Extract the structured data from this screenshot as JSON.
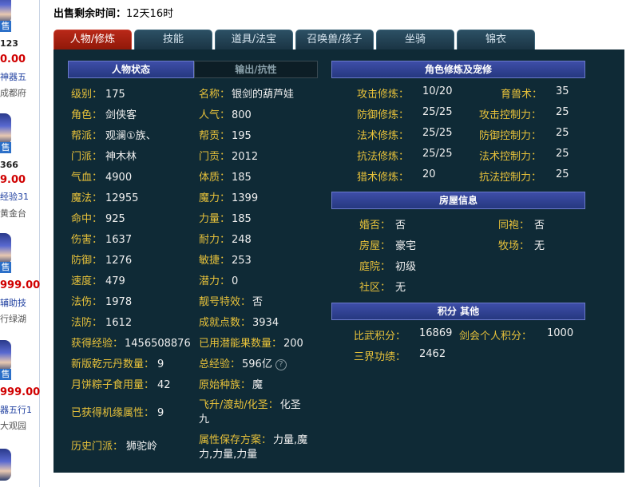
{
  "left_strip": {
    "items": [
      {
        "id": "123",
        "price": "0.00",
        "desc": "神器五",
        "server": "成都府",
        "badge": "售"
      },
      {
        "id": "366",
        "price": "9.00",
        "desc": "经验31",
        "server": "黄金台",
        "badge": "售"
      },
      {
        "id": "",
        "price": "999.00",
        "desc": "辅助技",
        "server": "行绿湖",
        "badge": "售"
      },
      {
        "id": "",
        "price": "999.00",
        "desc": "器五行1",
        "server": "大观园",
        "badge": "售"
      }
    ]
  },
  "sale": {
    "label": "出售剩余时间：",
    "value": "12天16时"
  },
  "tabs": [
    "人物/修炼",
    "技能",
    "道具/法宝",
    "召唤兽/孩子",
    "坐骑",
    "锦衣"
  ],
  "panel": {
    "left_header": "人物状态",
    "left_header2": "输出/抗性",
    "col1": [
      {
        "label": "级别：",
        "value": "175"
      },
      {
        "label": "角色：",
        "value": "剑侠客"
      },
      {
        "label": "帮派：",
        "value": "观澜①族、"
      },
      {
        "label": "门派：",
        "value": "神木林"
      },
      {
        "label": "气血：",
        "value": "4900"
      },
      {
        "label": "魔法：",
        "value": "12955"
      },
      {
        "label": "命中：",
        "value": "925"
      },
      {
        "label": "伤害：",
        "value": "1637"
      },
      {
        "label": "防御：",
        "value": "1276"
      },
      {
        "label": "速度：",
        "value": "479"
      },
      {
        "label": "法伤：",
        "value": "1978"
      },
      {
        "label": "法防：",
        "value": "1612"
      },
      {
        "label": "获得经验：",
        "value": "1456508876"
      },
      {
        "label": "新版乾元丹数量：",
        "value": "9"
      },
      {
        "label": "月饼粽子食用量：",
        "value": "42"
      },
      {
        "label": "已获得机缘属性：",
        "value": "9"
      },
      {
        "label": "历史门派：",
        "value": "狮驼岭"
      }
    ],
    "col2": [
      {
        "label": "名称：",
        "value": "银剑的葫芦娃"
      },
      {
        "label": "人气：",
        "value": "800"
      },
      {
        "label": "帮贡：",
        "value": "195"
      },
      {
        "label": "门贡：",
        "value": "2012"
      },
      {
        "label": "体质：",
        "value": "185"
      },
      {
        "label": "魔力：",
        "value": "1399"
      },
      {
        "label": "力量：",
        "value": "185"
      },
      {
        "label": "耐力：",
        "value": "248"
      },
      {
        "label": "敏捷：",
        "value": "253"
      },
      {
        "label": "潜力：",
        "value": "0"
      },
      {
        "label": "靓号特效：",
        "value": "否"
      },
      {
        "label": "成就点数：",
        "value": "3934"
      },
      {
        "label": "已用潜能果数量：",
        "value": "200"
      },
      {
        "label": "总经验：",
        "value": "596亿"
      }
    ],
    "fly": {
      "label": "飞升/渡劫/化圣：",
      "value": "化圣",
      "value2": "九"
    },
    "attr_plan": {
      "label": "属性保存方案：",
      "value": "力量,魔",
      "value2": "力,力量,力量"
    },
    "cultivation_header": "角色修炼及宠修",
    "cultivation": [
      {
        "label": "攻击修炼：",
        "value": "10/20",
        "label2": "育兽术：",
        "value2": "35"
      },
      {
        "label": "防御修炼：",
        "value": "25/25",
        "label2": "攻击控制力：",
        "value2": "25"
      },
      {
        "label": "法术修炼：",
        "value": "25/25",
        "label2": "防御控制力：",
        "value2": "25"
      },
      {
        "label": "抗法修炼：",
        "value": "25/25",
        "label2": "法术控制力：",
        "value2": "25"
      },
      {
        "label": "猎术修炼：",
        "value": "20",
        "label2": "抗法控制力：",
        "value2": "25"
      }
    ],
    "house_header": "房屋信息",
    "house": [
      {
        "label": "婚否：",
        "value": "否",
        "label2": "同袍：",
        "value2": "否"
      },
      {
        "label": "房屋：",
        "value": "豪宅",
        "label2": "牧场：",
        "value2": "无"
      },
      {
        "label": "庭院：",
        "value": "初级"
      },
      {
        "label": "社区：",
        "value": "无"
      }
    ],
    "score_header": "积分 其他",
    "score": [
      {
        "label": "比武积分：",
        "value": "16869",
        "label2": "剑会个人积分：",
        "value2": "1000"
      },
      {
        "label": "三界功绩：",
        "value": "2462"
      }
    ]
  }
}
